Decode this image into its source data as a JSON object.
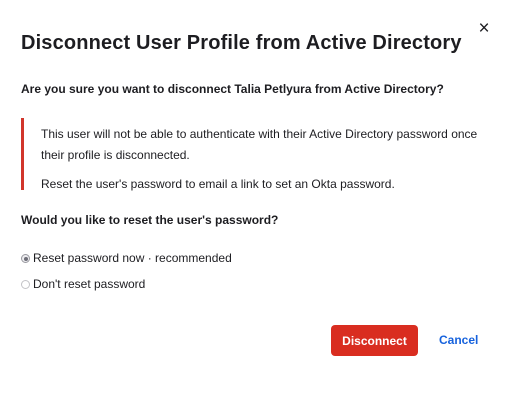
{
  "dialog": {
    "close_glyph": "×",
    "title": "Disconnect User Profile from Active Directory",
    "question": "Are you sure you want to disconnect Talia Petlyura from Active Directory?",
    "callout": {
      "line1": "This user will not be able to authenticate with their Active Directory password once their profile is disconnected.",
      "line2": "Reset the user's password to email a link to set an Okta password.",
      "accent_color": "#d1352b"
    },
    "reset_question": "Would you like to reset the user's password?",
    "options": [
      {
        "label": "Reset password now · recommended",
        "selected": true
      },
      {
        "label": "Don't reset password",
        "selected": false
      }
    ],
    "buttons": {
      "primary_label": "Disconnect",
      "primary_color": "#d92d20",
      "cancel_label": "Cancel",
      "cancel_color": "#1662dd"
    }
  }
}
